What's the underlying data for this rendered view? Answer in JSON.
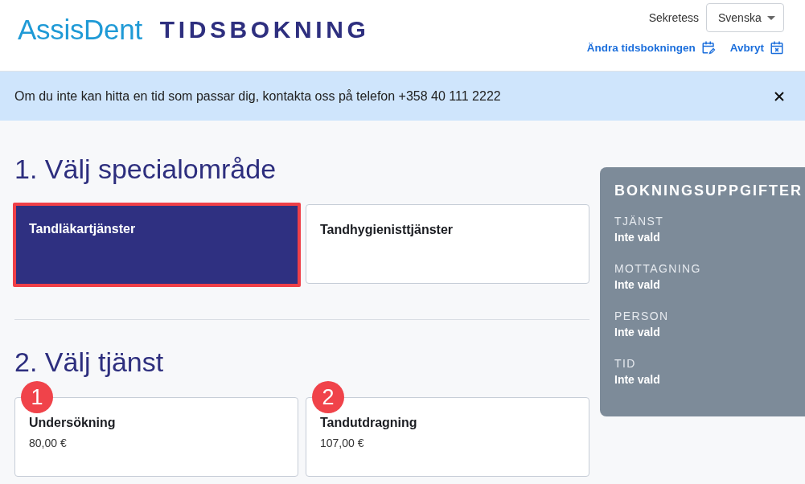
{
  "header": {
    "logo": "AssisDent",
    "title": "TIDSBOKNING",
    "privacy_link": "Sekretess",
    "language_select": {
      "value": "Svenska"
    },
    "links": [
      {
        "label": "Ändra tidsbokningen",
        "kind": "edit"
      },
      {
        "label": "Avbryt",
        "kind": "cancel"
      }
    ]
  },
  "notice": {
    "text": "Om du inte kan hitta en tid som passar dig, kontakta oss på telefon +358 40 111 2222"
  },
  "steps": [
    {
      "heading": "1. Välj specialområde",
      "options": [
        {
          "title": "Tandläkartjänster",
          "selected": true
        },
        {
          "title": "Tandhygienisttjänster",
          "selected": false
        }
      ]
    },
    {
      "heading": "2. Välj tjänst",
      "options": [
        {
          "title": "Undersökning",
          "price": "80,00 €",
          "marker": "1",
          "selected": false
        },
        {
          "title": "Tandutdragning",
          "price": "107,00 €",
          "marker": "2",
          "selected": false
        }
      ]
    }
  ],
  "summary": {
    "title": "BOKNINGSUPPGIFTER",
    "fields": [
      {
        "label": "TJÄNST",
        "value": "Inte vald"
      },
      {
        "label": "MOTTAGNING",
        "value": "Inte vald"
      },
      {
        "label": "PERSON",
        "value": "Inte vald"
      },
      {
        "label": "TID",
        "value": "Inte vald"
      }
    ]
  }
}
